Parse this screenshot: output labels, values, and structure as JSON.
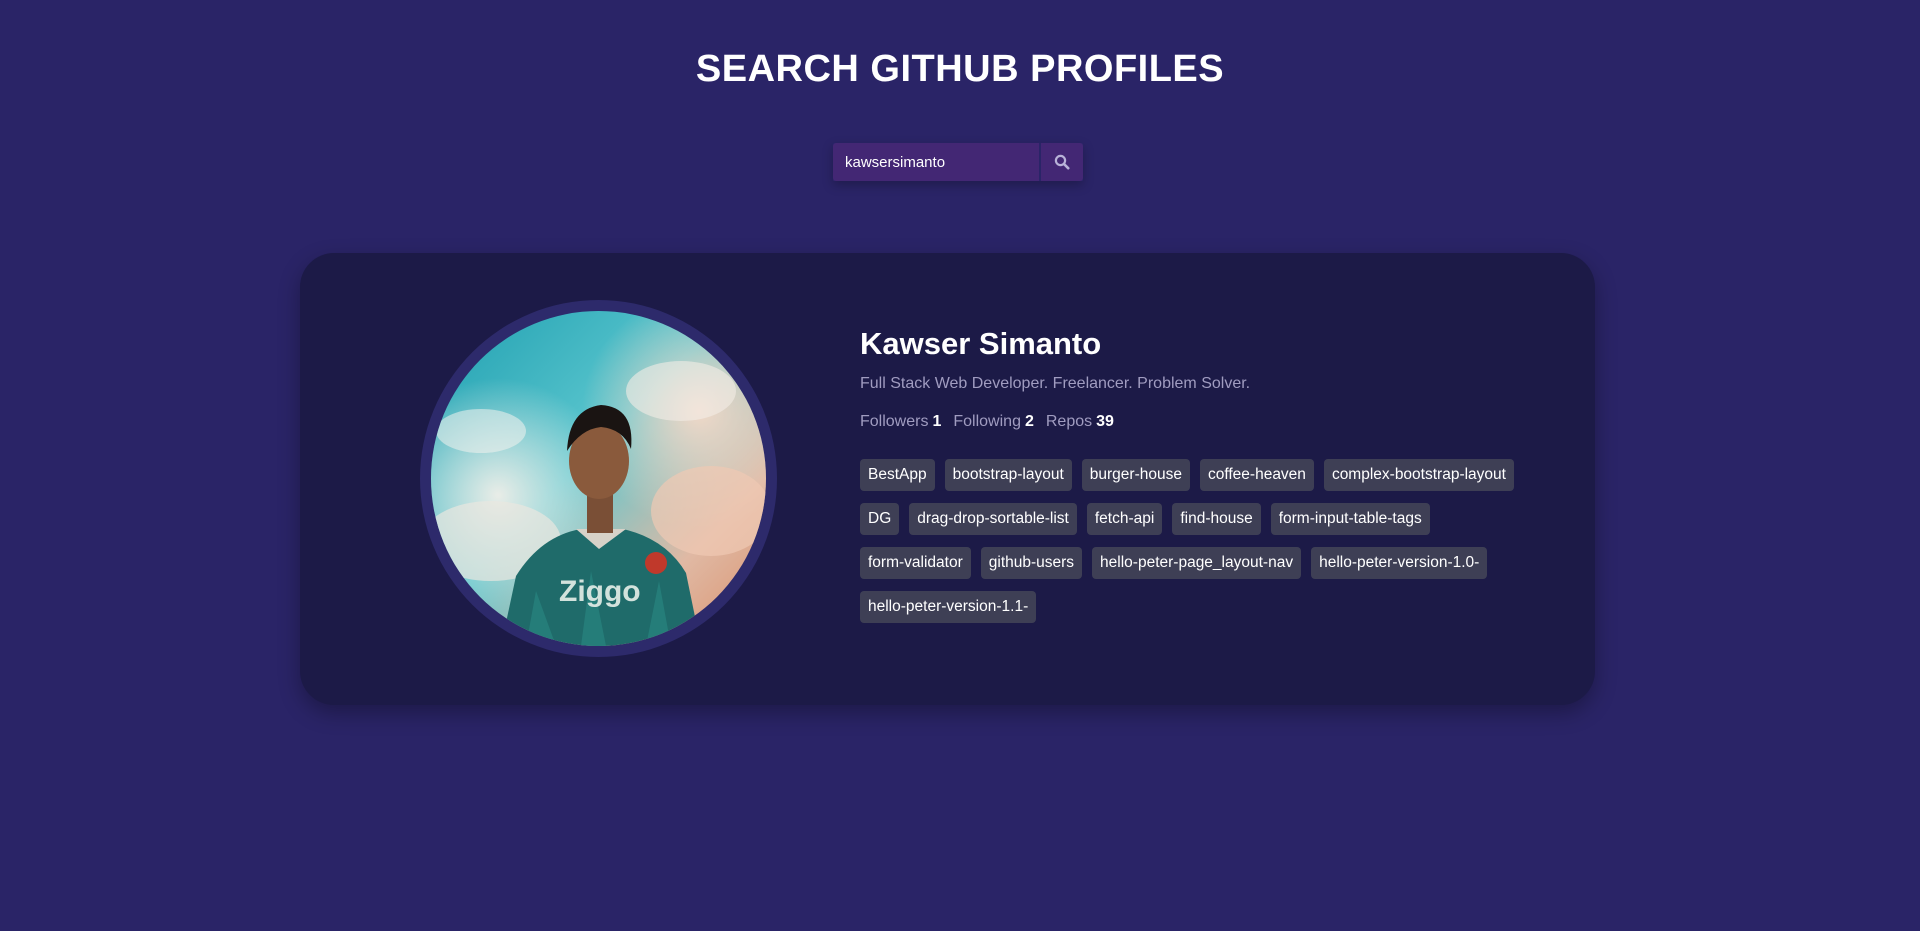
{
  "header": {
    "title": "SEARCH GITHUB PROFILES"
  },
  "search": {
    "value": "kawsersimanto",
    "button_icon": "search-icon"
  },
  "profile": {
    "name": "Kawser Simanto",
    "bio": "Full Stack Web Developer. Freelancer. Problem Solver.",
    "stats": [
      {
        "label": "Followers",
        "value": "1"
      },
      {
        "label": "Following",
        "value": "2"
      },
      {
        "label": "Repos",
        "value": "39"
      }
    ],
    "repos": [
      "BestApp",
      "bootstrap-layout",
      "burger-house",
      "coffee-heaven",
      "complex-bootstrap-layout",
      "DG",
      "drag-drop-sortable-list",
      "fetch-api",
      "find-house",
      "form-input-table-tags",
      "form-validator",
      "github-users",
      "hello-peter-page_layout-nav",
      "hello-peter-version-1.0-",
      "hello-peter-version-1.1-"
    ]
  },
  "colors": {
    "background": "#2a2467",
    "card": "#1c1a47",
    "search_bg": "#432774",
    "repo_tag": "#3e3f55",
    "muted_text": "#a09cc0"
  }
}
